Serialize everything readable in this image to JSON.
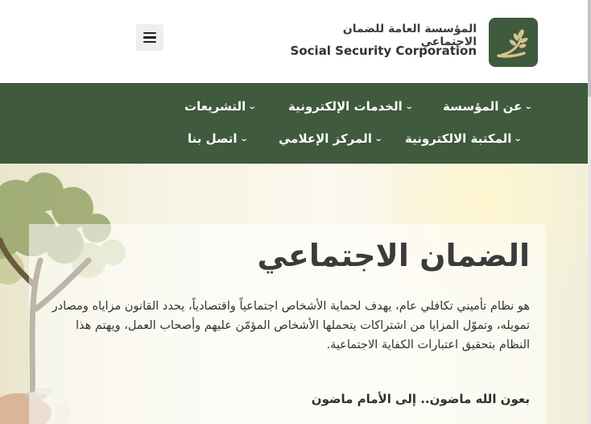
{
  "brand": {
    "name_ar": "المؤسسة العامة للضمان الاجتماعي",
    "name_en": "Social Security Corporation"
  },
  "nav": {
    "row1": [
      {
        "label": "عن المؤسسة"
      },
      {
        "label": "الخدمات الإلكترونية"
      },
      {
        "label": "التشريعات"
      }
    ],
    "row2": [
      {
        "label": "المكتبة الالكترونية"
      },
      {
        "label": "المركز الإعلامي"
      },
      {
        "label": "اتصل بنا"
      }
    ]
  },
  "hero": {
    "title": "الضمان الاجتماعي",
    "paragraph": "هو نظام تأميني تكافلي عام، يهدف لحماية الأشخاص اجتماعياً واقتصادياً، يحدد القانون مزاياه ومصادر تمويله، وتموّل المزايا من اشتراكات يتحملها الأشخاص المؤمّن عليهم وأصحاب العمل، ويهتم هذا النظام بتحقيق اعتبارات الكفاية الاجتماعية.",
    "motto": "بعون الله ماضون.. إلى الأمام ماضون"
  },
  "colors": {
    "nav_bg": "#3f5a3d",
    "logo_bg": "#3f5a3d",
    "logo_accent": "#d8c38a"
  },
  "icons": {
    "menu": "hamburger-menu-icon",
    "chevron": "chevron-down-icon",
    "logo": "wheat-logo-icon"
  }
}
